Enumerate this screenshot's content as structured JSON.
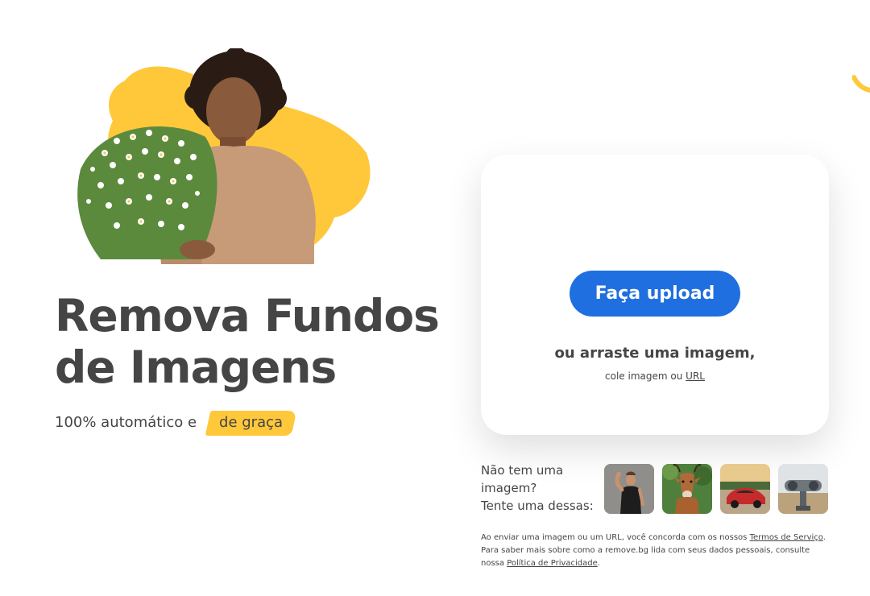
{
  "hero": {
    "headline_line1": "Remova Fundos",
    "headline_line2": "de Imagens",
    "subline": "100% automático e",
    "subline_highlight": "de graça"
  },
  "upload": {
    "button_label": "Faça upload",
    "drag_text": "ou arraste uma imagem,",
    "paste_prefix": "cole imagem ou",
    "url_link": "URL"
  },
  "samples": {
    "label_line1": "Não tem uma",
    "label_line2": "imagem?",
    "label_line3": "Tente uma dessas:",
    "items": [
      "woman-sample",
      "antelope-sample",
      "car-sample",
      "binoculars-sample"
    ]
  },
  "legal": {
    "part1": "Ao enviar uma imagem ou um URL, você concorda com os nossos",
    "terms_link": "Termos de Serviço",
    "part2": ". Para saber mais sobre como a remove.bg lida com seus dados pessoais, consulte nossa",
    "privacy_link": "Política de Privacidade",
    "part3": "."
  },
  "colors": {
    "accent_blue": "#1f6fe0",
    "brand_yellow": "#ffc83b",
    "text_dark": "#454545"
  }
}
